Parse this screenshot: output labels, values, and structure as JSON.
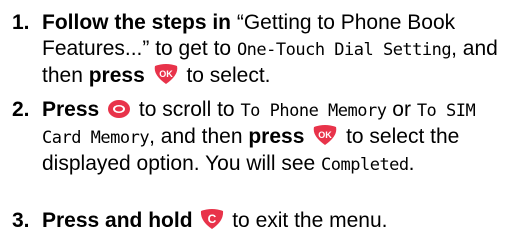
{
  "steps": [
    {
      "number": "1.",
      "t1": "Follow the steps in",
      "t2": " “Getting to Phone Book Features...” to get to ",
      "lcd1": "One-Touch Dial Setting",
      "t3": ", and then ",
      "t4": "press",
      "t5": " to select."
    },
    {
      "number": "2.",
      "t1": "Press",
      "t2": " to scroll to ",
      "lcd1": "To Phone Memory",
      "t3": " or ",
      "lcd2": "To SIM Card Memory",
      "t4": ", and then ",
      "t5": "press",
      "t6": " to select the displayed option. You will see ",
      "lcd3": "Completed",
      "t7": "."
    },
    {
      "number": "3.",
      "t1": "Press and hold",
      "t2": " to exit the menu."
    }
  ],
  "keys": {
    "ok_label": "OK",
    "clear_label": "C",
    "icon_color": "#e8334a"
  }
}
